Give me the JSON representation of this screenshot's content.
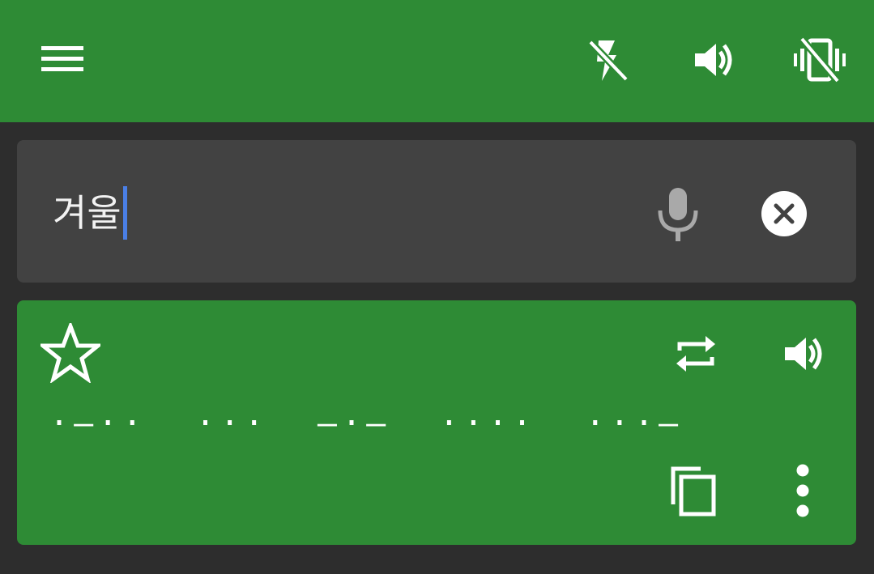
{
  "app_bar": {
    "icons": {
      "menu": "menu-icon",
      "flash": "flash-off-icon",
      "volume": "volume-up-icon",
      "vibrate": "vibration-off-icon"
    },
    "color": "#2e8b35"
  },
  "input": {
    "value": "겨울",
    "icons": {
      "mic": "mic-icon",
      "clear": "clear-circle-icon"
    }
  },
  "output": {
    "morse": "·–··  ···  –·–  ····  ···–",
    "icons": {
      "favorite": "star-outline-icon",
      "repeat": "repeat-icon",
      "speak": "volume-up-icon",
      "copy": "copy-icon",
      "more": "more-vert-icon"
    }
  },
  "colors": {
    "primary": "#2e8b35",
    "background": "#2d2d2d",
    "input_card": "#424242",
    "caret": "#4a7fe6"
  }
}
